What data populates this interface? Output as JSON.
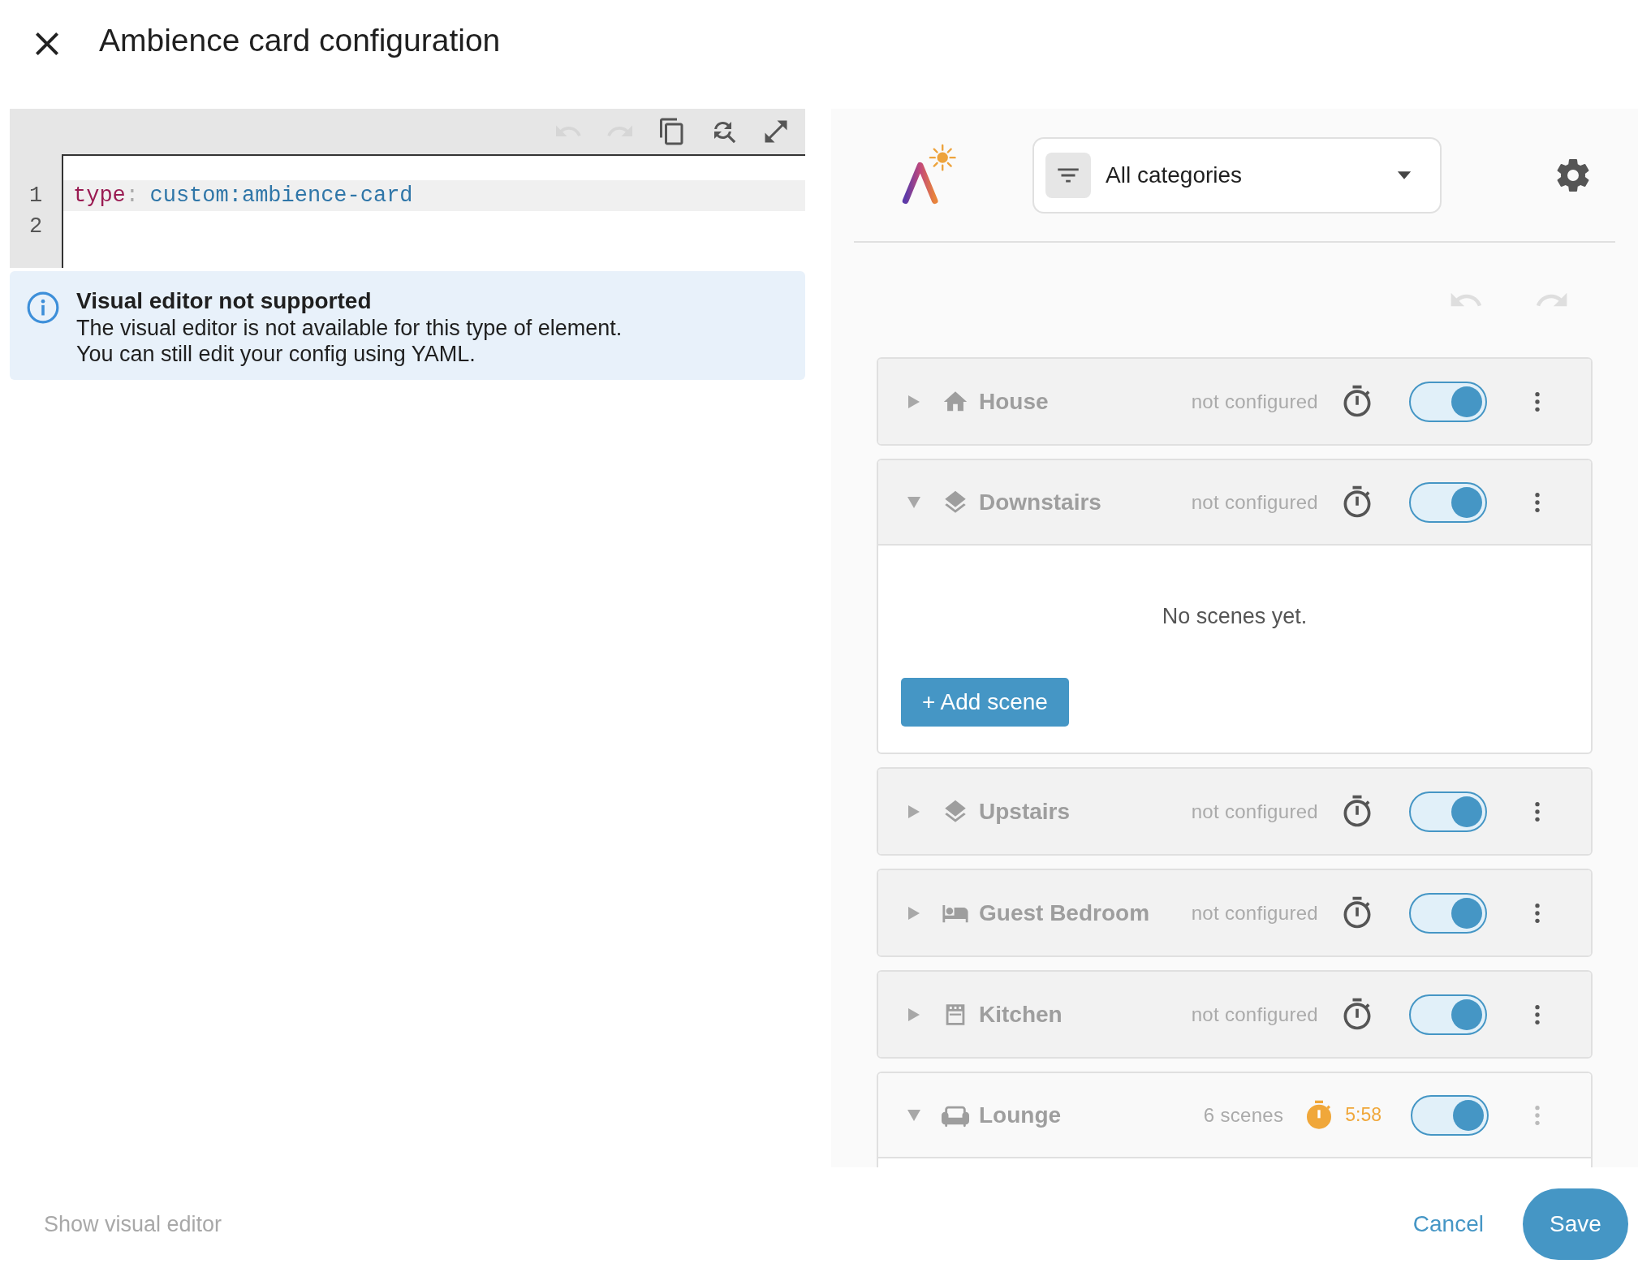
{
  "dialog": {
    "title": "Ambience card configuration"
  },
  "editor": {
    "toolbar": [
      {
        "disabled": true
      },
      {
        "disabled": true
      },
      {
        "disabled": false
      },
      {
        "disabled": false
      },
      {
        "disabled": false
      }
    ],
    "lines": [
      {
        "number": "1",
        "key": "type",
        "separator": ":",
        "value": "custom:ambience-card",
        "active": true
      },
      {
        "number": "2",
        "active": false
      }
    ]
  },
  "alert": {
    "title": "Visual editor not supported",
    "lines": [
      "The visual editor is not available for this type of element.",
      "You can still edit your config using YAML."
    ]
  },
  "filter": {
    "value": "All categories"
  },
  "history": {
    "undo_disabled": true,
    "redo_disabled": true
  },
  "areas": [
    {
      "name": "House",
      "status": "not configured",
      "expanded": false,
      "on": true,
      "timer_running": false
    },
    {
      "name": "Downstairs",
      "status": "not configured",
      "expanded": true,
      "on": true,
      "timer_running": false,
      "empty_text": "No scenes yet.",
      "add_label": "+ Add scene"
    },
    {
      "name": "Upstairs",
      "status": "not configured",
      "expanded": false,
      "on": true,
      "timer_running": false
    },
    {
      "name": "Guest Bedroom",
      "status": "not configured",
      "expanded": false,
      "on": true,
      "timer_running": false
    },
    {
      "name": "Kitchen",
      "status": "not configured",
      "expanded": false,
      "on": true,
      "timer_running": false
    },
    {
      "name": "Lounge",
      "status": "6 scenes",
      "expanded": true,
      "on": true,
      "timer_running": true,
      "timer": "5:58"
    }
  ],
  "footer": {
    "visual_editor": {
      "label": "Show visual editor",
      "disabled": true
    },
    "cancel": "Cancel",
    "save": "Save"
  }
}
